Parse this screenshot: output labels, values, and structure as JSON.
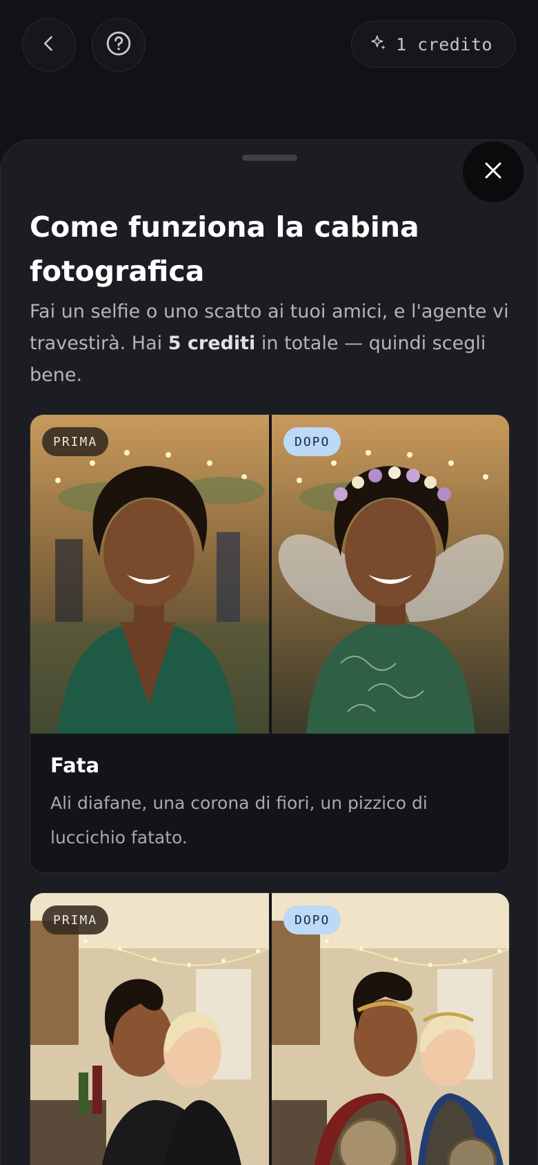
{
  "header": {
    "back_icon": "chevron-left-icon",
    "help_icon": "question-circle-icon",
    "credit_icon": "sparkle-icon",
    "credit_label": "1 credito"
  },
  "sheet": {
    "close_icon": "close-icon",
    "title": "Come funziona la cabina fotografica",
    "subtitle_pre": "Fai un selfie o uno scatto ai tuoi amici, e l'agente vi travestirà. Hai ",
    "subtitle_bold": "5 crediti",
    "subtitle_post": " in totale — quindi scegli bene."
  },
  "examples": [
    {
      "before_label": "PRIMA",
      "after_label": "DOPO",
      "title": "Fata",
      "description": "Ali diafane, una corona di fiori, un pizzico di luccichio fatato."
    },
    {
      "before_label": "PRIMA",
      "after_label": "DOPO"
    }
  ],
  "colors": {
    "background": "#111216",
    "sheet": "#1c1d22",
    "badge_after": "#bcd9f7",
    "badge_before": "#342a20"
  }
}
